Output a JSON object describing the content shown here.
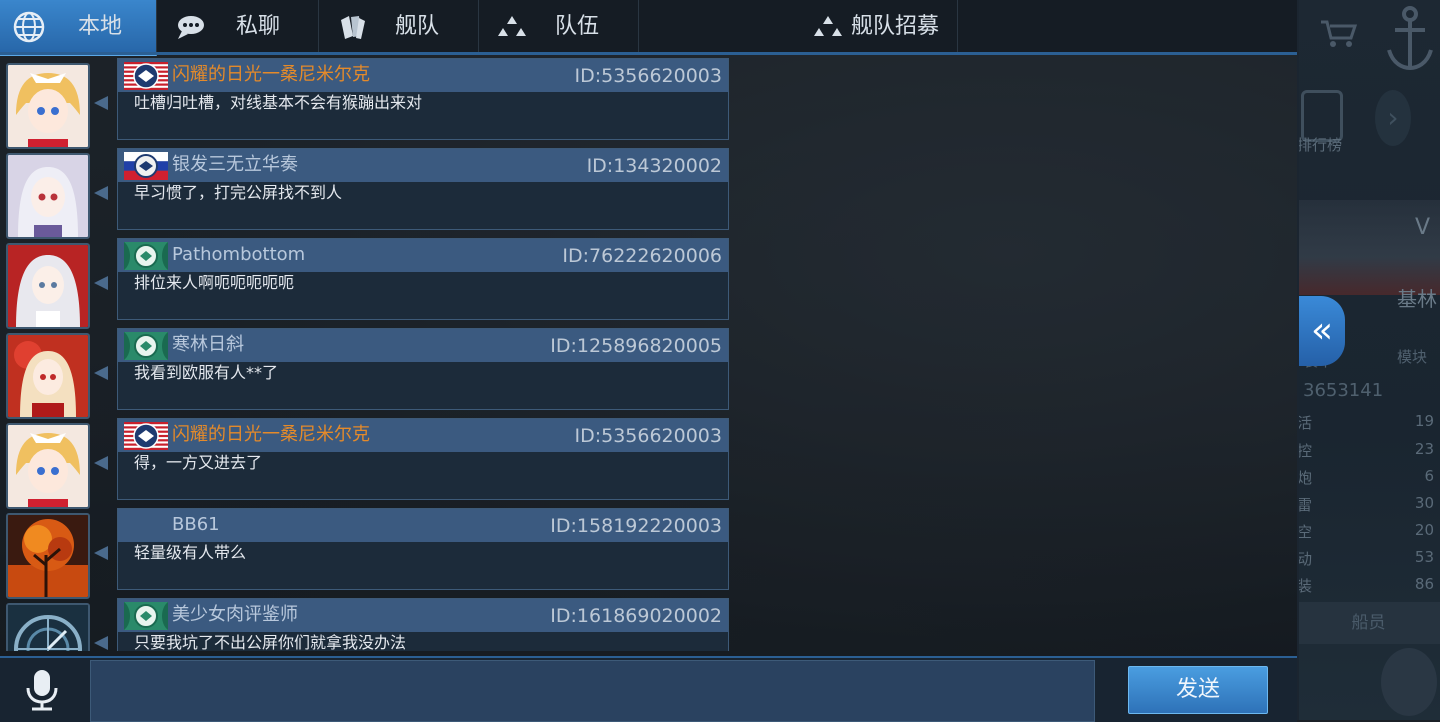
{
  "tabs": [
    {
      "label": "本地",
      "icon": "globe-icon",
      "active": true
    },
    {
      "label": "私聊",
      "icon": "chat-bubble-icon",
      "active": false
    },
    {
      "label": "舰队",
      "icon": "cards-icon",
      "active": false
    },
    {
      "label": "队伍",
      "icon": "team-icon",
      "active": false
    },
    {
      "label": "舰队招募",
      "icon": "team-icon",
      "active": false
    }
  ],
  "messages": [
    {
      "name": "闪耀的日光一桑尼米尔克",
      "id": "ID:5356620003",
      "text": "吐槽归吐槽，对线基本不会有猴蹦出来对",
      "flag": "usa",
      "name_color": "orange",
      "avatar": "blonde-maid"
    },
    {
      "name": "银发三无立华奏",
      "id": "ID:134320002",
      "text": "早习惯了，打完公屏找不到人",
      "flag": "russia",
      "name_color": "blue",
      "avatar": "silver-hair"
    },
    {
      "name": "Pathombottom",
      "id": "ID:76222620006",
      "text": "排位来人啊呃呃呃呃呃",
      "flag": "green-emblem",
      "name_color": "blue",
      "avatar": "white-hair"
    },
    {
      "name": "寒林日斜",
      "id": "ID:125896820005",
      "text": "我看到欧服有人**了",
      "flag": "green-emblem",
      "name_color": "blue",
      "avatar": "red-dress"
    },
    {
      "name": "闪耀的日光一桑尼米尔克",
      "id": "ID:5356620003",
      "text": "得，一方又进去了",
      "flag": "usa",
      "name_color": "orange",
      "avatar": "blonde-maid"
    },
    {
      "name": "BB61",
      "id": "ID:158192220003",
      "text": "轻量级有人带么",
      "flag": "none",
      "name_color": "blue",
      "avatar": "autumn-tree"
    },
    {
      "name": "美少女肉评鉴师",
      "id": "ID:161869020002",
      "text": "只要我坑了不出公屏你们就拿我没办法",
      "flag": "green-emblem",
      "name_color": "blue",
      "avatar": "compass"
    }
  ],
  "input": {
    "send_label": "发送",
    "mic_icon": "microphone-icon"
  },
  "collapse": {
    "icon": "double-chevron-left-icon",
    "glyph": "«"
  },
  "side_panel": {
    "rank_label": "排行榜",
    "ship_tier": "V",
    "base_label": "基林",
    "fire_label": "装甲",
    "module_label": "模块",
    "stat_id": "3653141",
    "stats": [
      {
        "label": "活",
        "value": "19"
      },
      {
        "label": "控",
        "value": "23"
      },
      {
        "label": "炮",
        "value": "6"
      },
      {
        "label": "雷",
        "value": "30"
      },
      {
        "label": "空",
        "value": "20"
      },
      {
        "label": "动",
        "value": "53"
      },
      {
        "label": "装",
        "value": "86"
      }
    ],
    "crew_label": "船员"
  },
  "colors": {
    "accent": "#2e72b8",
    "name_orange": "#e48a2a",
    "header_blue": "#3b5a80"
  }
}
